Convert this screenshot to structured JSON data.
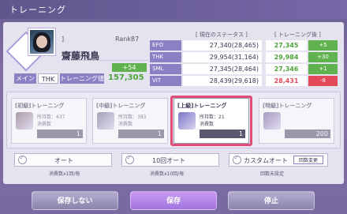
{
  "header": {
    "title": "トレーニング"
  },
  "character": {
    "subtitle": "]",
    "rank": "Rank87",
    "name": "齋藤飛鳥",
    "plus_badge": "+54",
    "role_main": "メイン",
    "role_type": "THK",
    "total_label": "トレーニング値",
    "total_value": "157,305"
  },
  "stats": {
    "current_header": "[ 現在のステータス ]",
    "after_header": "[ トレーニング後 ]",
    "rows": [
      {
        "label": "EFO",
        "current": "27,340(28,465)",
        "after": "27,345",
        "diff": "+5",
        "after_color": "#4da33b",
        "diff_color": "#5fb24d"
      },
      {
        "label": "THK",
        "current": "29,954(31,164)",
        "after": "29,984",
        "diff": "+30",
        "after_color": "#4da33b",
        "diff_color": "#5fb24d"
      },
      {
        "label": "SML",
        "current": "27,345(28,464)",
        "after": "27,346",
        "diff": "+1",
        "after_color": "#4da33b",
        "diff_color": "#5fb24d"
      },
      {
        "label": "VIT",
        "current": "28,439(29,618)",
        "after": "28,431",
        "diff": "-8",
        "after_color": "#e24a5a",
        "diff_color": "#e24a5a"
      }
    ]
  },
  "training_cards": [
    {
      "title": "[初級]トレーニング",
      "own": "所持数：437",
      "cost": "消費数",
      "count": "1",
      "img_color": "#7c5a6c",
      "selected": false,
      "dim": true
    },
    {
      "title": "[中級]トレーニング",
      "own": "所持数：383",
      "cost": "消費数",
      "count": "1",
      "img_color": "#6a6a88",
      "selected": false,
      "dim": true
    },
    {
      "title": "[上級]トレーニング",
      "own": "所持数：21",
      "cost": "消費数",
      "count": "1",
      "img_color": "#7a78c8",
      "selected": true,
      "dim": false
    },
    {
      "title": "[特級]トレーニング",
      "own": "",
      "cost": "",
      "count": "200",
      "img_color": "#6e5a9a",
      "selected": false,
      "dim": true
    }
  ],
  "auto": {
    "auto_label": "オート",
    "auto_note": "消費数x1回/毎",
    "auto10_label": "10回オート",
    "auto10_note": "消費数x10回/毎",
    "custom_label": "カスタムオート",
    "custom_note": "回数未設定",
    "change_label": "回数変更"
  },
  "buttons": {
    "no_save": "保存しない",
    "save": "保存",
    "stop": "停止"
  },
  "colors": {
    "accent": "#8c7fc4",
    "selected_frame": "#e24a78",
    "positive": "#5fb24d",
    "negative": "#e24a5a"
  }
}
